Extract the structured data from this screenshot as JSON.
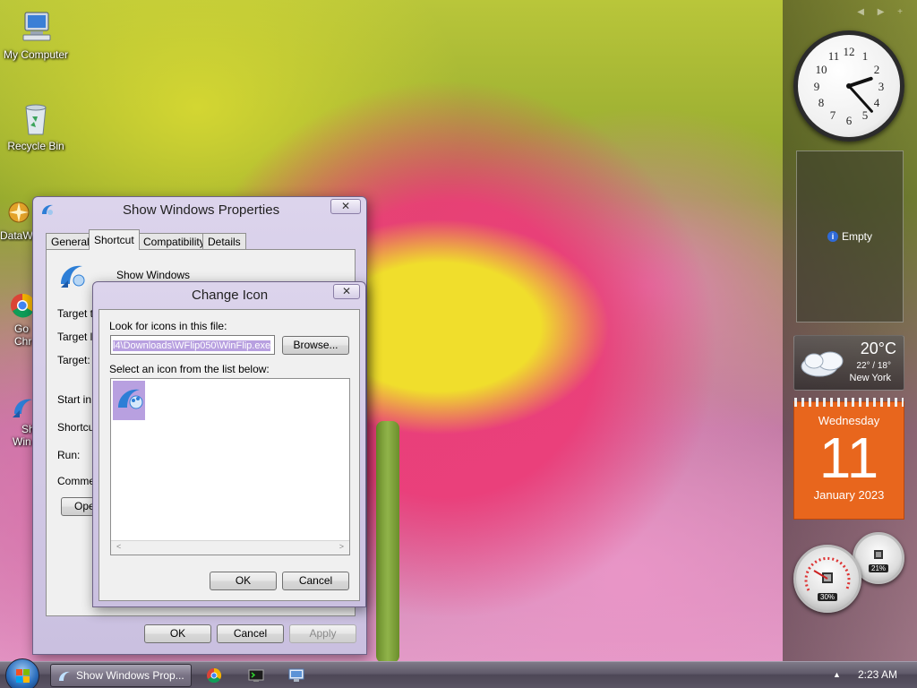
{
  "desktop_icons": [
    {
      "label": "My Computer",
      "icon": "computer-icon"
    },
    {
      "label": "Recycle Bin",
      "icon": "recycle-bin-icon"
    },
    {
      "label": "DataW",
      "icon": "app-icon"
    },
    {
      "label": "Go",
      "label2": "Chr",
      "icon": "chrome-icon"
    },
    {
      "label": "Sh",
      "label2": "Win",
      "icon": "show-windows-icon"
    }
  ],
  "sidebar": {
    "slideshow_text": "Empty",
    "weather": {
      "temp": "20°C",
      "range": "22° / 18°",
      "city": "New York"
    },
    "calendar": {
      "weekday": "Wednesday",
      "day": "11",
      "month_year": "January 2023"
    },
    "cpu_percent": "30%",
    "memory_percent": "21%",
    "clock": {
      "hour": 2,
      "minute": 23
    }
  },
  "properties_dialog": {
    "title": "Show Windows Properties",
    "tabs": [
      "General",
      "Shortcut",
      "Compatibility",
      "Details"
    ],
    "active_tab": "Shortcut",
    "name": "Show Windows",
    "field_labels": [
      "Target t",
      "Target lo",
      "Target:",
      "Start in:",
      "Shortcut",
      "Run:",
      "Commen"
    ],
    "open_button": "Ope",
    "ok": "OK",
    "cancel": "Cancel",
    "apply": "Apply"
  },
  "change_icon_dialog": {
    "title": "Change Icon",
    "look_label": "Look for icons in this file:",
    "file_path": "l4\\Downloads\\WFlip050\\WinFlip.exe",
    "browse": "Browse...",
    "select_label": "Select an icon from the list below:",
    "ok": "OK",
    "cancel": "Cancel"
  },
  "taskbar": {
    "active_task": "Show Windows Prop...",
    "time": "2:23 AM"
  },
  "colors": {
    "calendar_orange": "#e8661d",
    "selection_highlight": "#b8a0e0",
    "dialog_frame": "#cac0e0"
  }
}
